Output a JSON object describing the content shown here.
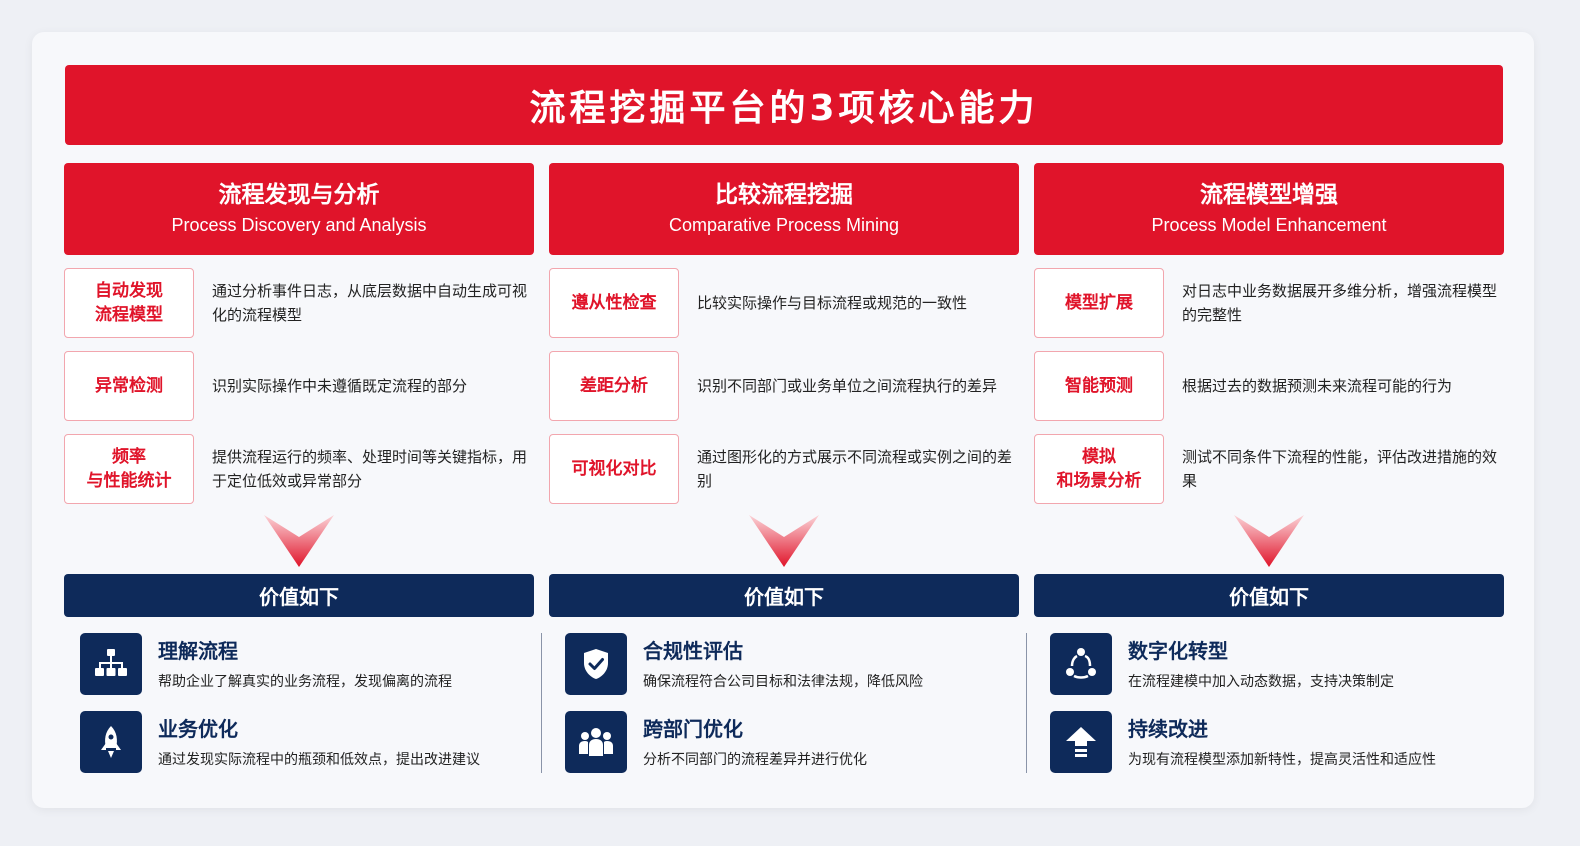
{
  "title": "流程挖掘平台的3项核心能力",
  "colors": {
    "primary_red": "#e0142a",
    "navy": "#0e2a5a",
    "label_border": "#f2a6ae"
  },
  "columns": [
    {
      "title_zh": "流程发现与分析",
      "title_en": "Process Discovery and Analysis",
      "features": [
        {
          "label": "自动发现\n流程模型",
          "desc": "通过分析事件日志，从底层数据中自动生成可视化的流程模型"
        },
        {
          "label": "异常检测",
          "desc": "识别实际操作中未遵循既定流程的部分"
        },
        {
          "label": "频率\n与性能统计",
          "desc": "提供流程运行的频率、处理时间等关键指标，用于定位低效或异常部分"
        }
      ],
      "value_label": "价值如下",
      "benefits": [
        {
          "icon": "org-chart-icon",
          "title": "理解流程",
          "desc": "帮助企业了解真实的业务流程，发现偏离的流程"
        },
        {
          "icon": "rocket-icon",
          "title": "业务优化",
          "desc": "通过发现实际流程中的瓶颈和低效点，提出改进建议"
        }
      ]
    },
    {
      "title_zh": "比较流程挖掘",
      "title_en": "Comparative Process Mining",
      "features": [
        {
          "label": "遵从性检查",
          "desc": "比较实际操作与目标流程或规范的一致性"
        },
        {
          "label": "差距分析",
          "desc": "识别不同部门或业务单位之间流程执行的差异"
        },
        {
          "label": "可视化对比",
          "desc": "通过图形化的方式展示不同流程或实例之间的差别"
        }
      ],
      "value_label": "价值如下",
      "benefits": [
        {
          "icon": "shield-check-icon",
          "title": "合规性评估",
          "desc": "确保流程符合公司目标和法律法规，降低风险"
        },
        {
          "icon": "team-icon",
          "title": "跨部门优化",
          "desc": "分析不同部门的流程差异并进行优化"
        }
      ]
    },
    {
      "title_zh": "流程模型增强",
      "title_en": "Process Model Enhancement",
      "features": [
        {
          "label": "模型扩展",
          "desc": "对日志中业务数据展开多维分析，增强流程模型的完整性"
        },
        {
          "label": "智能预测",
          "desc": "根据过去的数据预测未来流程可能的行为"
        },
        {
          "label": "模拟\n和场景分析",
          "desc": "测试不同条件下流程的性能，评估改进措施的效果"
        }
      ],
      "value_label": "价值如下",
      "benefits": [
        {
          "icon": "cycle-icon",
          "title": "数字化转型",
          "desc": "在流程建模中加入动态数据，支持决策制定"
        },
        {
          "icon": "upgrade-arrow-icon",
          "title": "持续改进",
          "desc": "为现有流程模型添加新特性，提高灵活性和适应性"
        }
      ]
    }
  ]
}
